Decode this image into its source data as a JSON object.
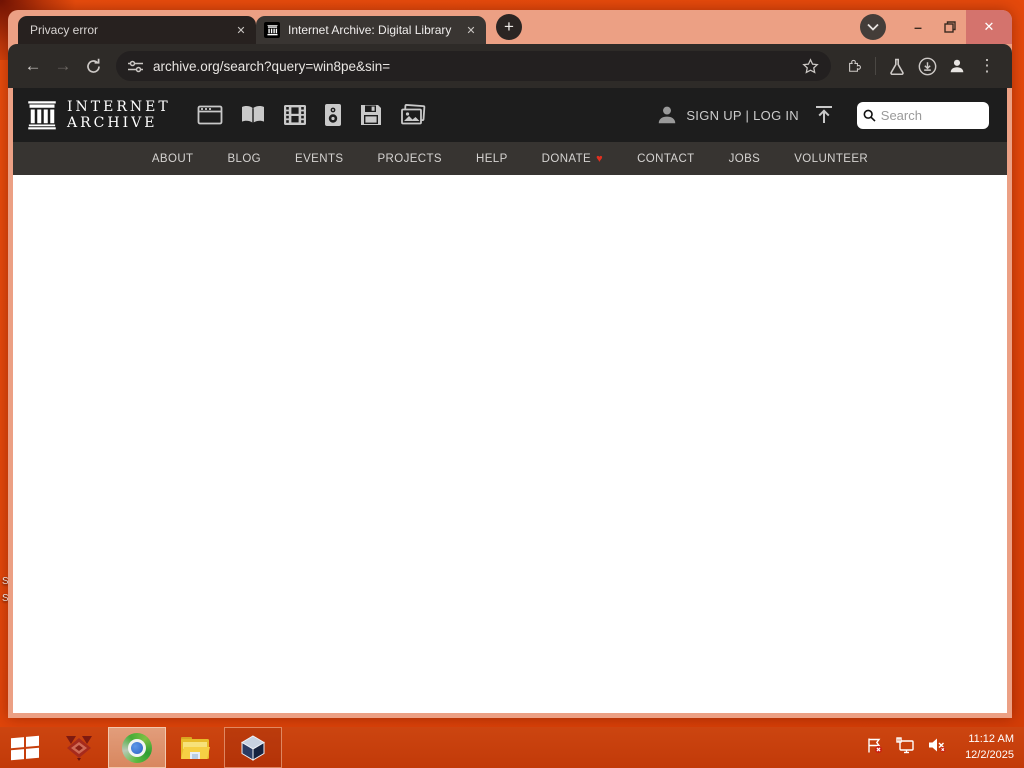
{
  "colors": {
    "desktop": "#e2470b",
    "taskbar": "#c6400c",
    "window_frame": "#eca084",
    "toolbar": "#2e2b28",
    "ia_header": "#1d1d1d",
    "ia_nav": "#373431",
    "close_button": "#d4736d",
    "donate_heart": "#e03020"
  },
  "glyphs": {
    "plus": "+",
    "close": "✕",
    "minimize": "–",
    "kebab": "⋮",
    "back": "←",
    "forward": "→",
    "heart": "♥"
  },
  "browser": {
    "tabs": [
      {
        "title": "Privacy error",
        "active": false
      },
      {
        "title": "Internet Archive: Digital Library",
        "active": true,
        "favicon": "internet-archive"
      }
    ],
    "url": "archive.org/search?query=win8pe&sin="
  },
  "page": {
    "logo": {
      "line1": "INTERNET",
      "line2": "ARCHIVE"
    },
    "media_icons": [
      "web",
      "texts",
      "video",
      "audio",
      "software",
      "images"
    ],
    "auth_label": "SIGN UP | LOG IN",
    "search_placeholder": "Search",
    "nav": [
      "ABOUT",
      "BLOG",
      "EVENTS",
      "PROJECTS",
      "HELP",
      "DONATE",
      "CONTACT",
      "JOBS",
      "VOLUNTEER"
    ]
  },
  "taskbar": {
    "apps": [
      "start",
      "red-app",
      "chrome-browser",
      "file-explorer",
      "virtualbox"
    ],
    "tray_icons": [
      "action-center-flag",
      "network",
      "volume-muted"
    ],
    "clock": {
      "time": "11:12 AM",
      "date": "12/2/2025"
    }
  },
  "desktop": {
    "labels": [
      "S",
      "S"
    ]
  }
}
